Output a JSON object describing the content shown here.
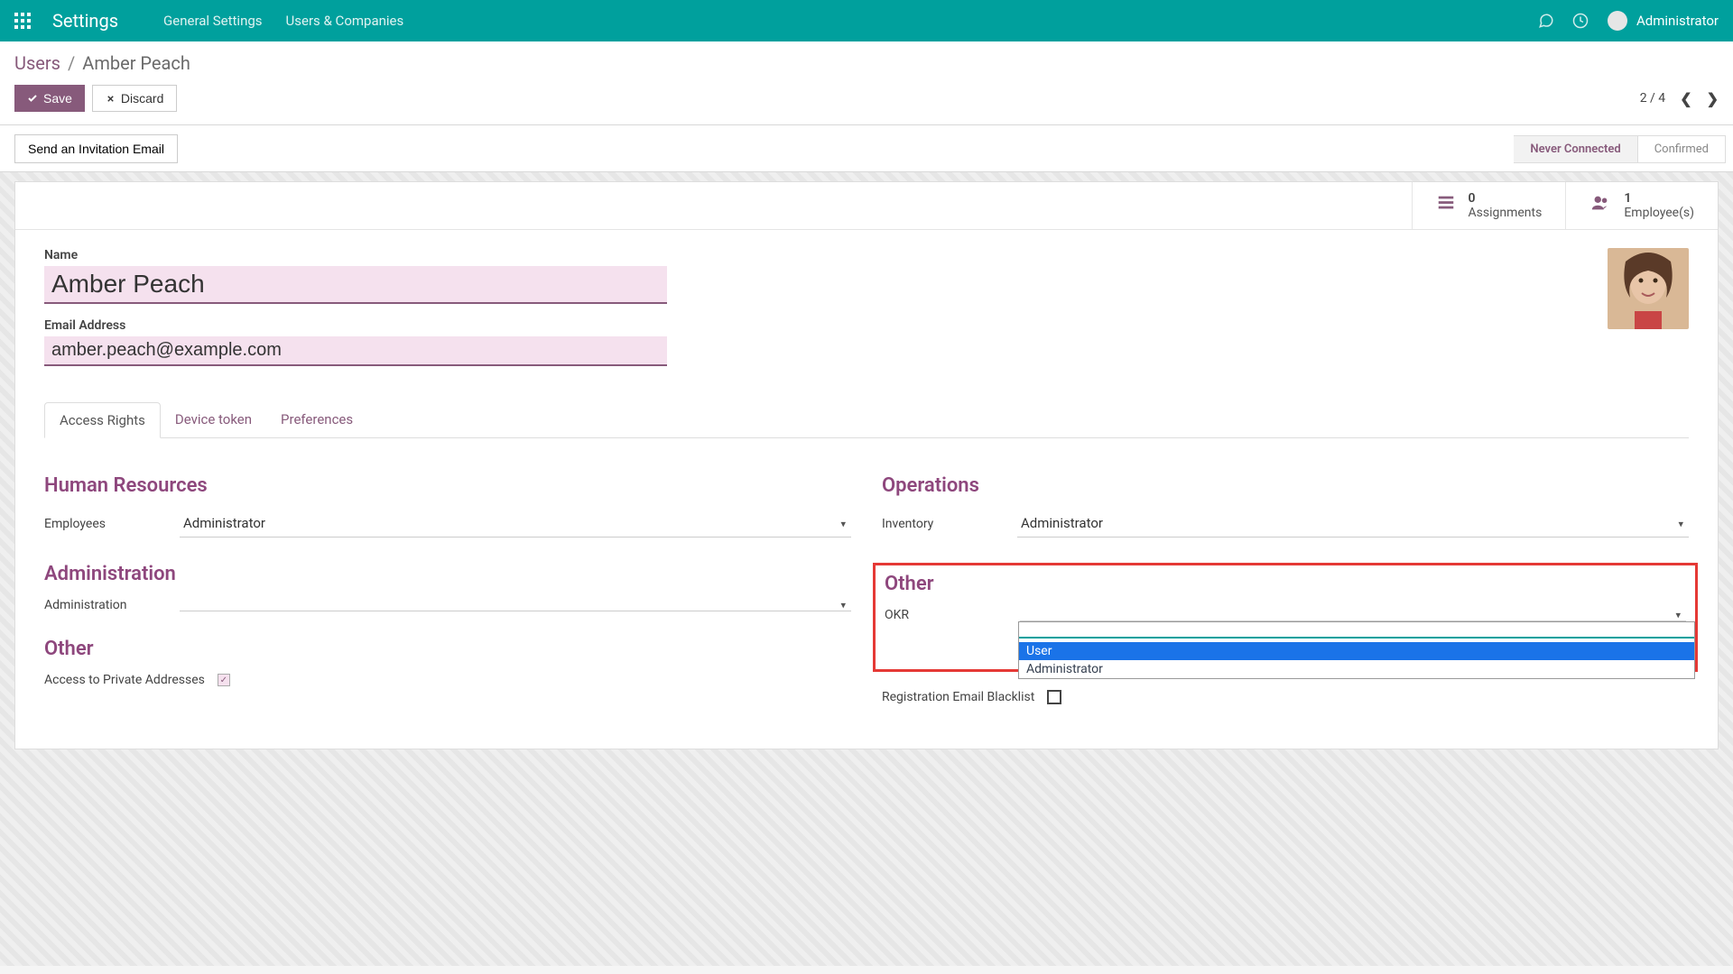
{
  "nav": {
    "brand": "Settings",
    "links": [
      "General Settings",
      "Users & Companies"
    ],
    "username": "Administrator"
  },
  "breadcrumb": {
    "parent": "Users",
    "current": "Amber Peach"
  },
  "actions": {
    "save": "Save",
    "discard": "Discard",
    "pager": "2 / 4"
  },
  "statusbar": {
    "send_btn": "Send an Invitation Email",
    "steps": [
      "Never Connected",
      "Confirmed"
    ],
    "active_index": 0
  },
  "stats": {
    "assignments": {
      "count": "0",
      "label": "Assignments"
    },
    "employees": {
      "count": "1",
      "label": "Employee(s)"
    }
  },
  "form": {
    "name_label": "Name",
    "name": "Amber Peach",
    "email_label": "Email Address",
    "email": "amber.peach@example.com"
  },
  "tabs": [
    "Access Rights",
    "Device token",
    "Preferences"
  ],
  "tab_active": 0,
  "sections": {
    "hr": {
      "title": "Human Resources",
      "rows": [
        {
          "label": "Employees",
          "value": "Administrator"
        }
      ]
    },
    "ops": {
      "title": "Operations",
      "rows": [
        {
          "label": "Inventory",
          "value": "Administrator"
        }
      ]
    },
    "admin": {
      "title": "Administration",
      "rows": [
        {
          "label": "Administration",
          "value": ""
        }
      ]
    },
    "other_right": {
      "title": "Other",
      "rows": [
        {
          "label": "OKR",
          "value": ""
        }
      ]
    },
    "other_left": {
      "title": "Other",
      "rows": [
        {
          "label": "Access to Private Addresses",
          "checked": true
        }
      ]
    },
    "reg_blacklist": {
      "label": "Registration Email Blacklist",
      "checked": false
    }
  },
  "dropdown": {
    "options": [
      "",
      "User",
      "Administrator"
    ],
    "selected_index": 1
  }
}
